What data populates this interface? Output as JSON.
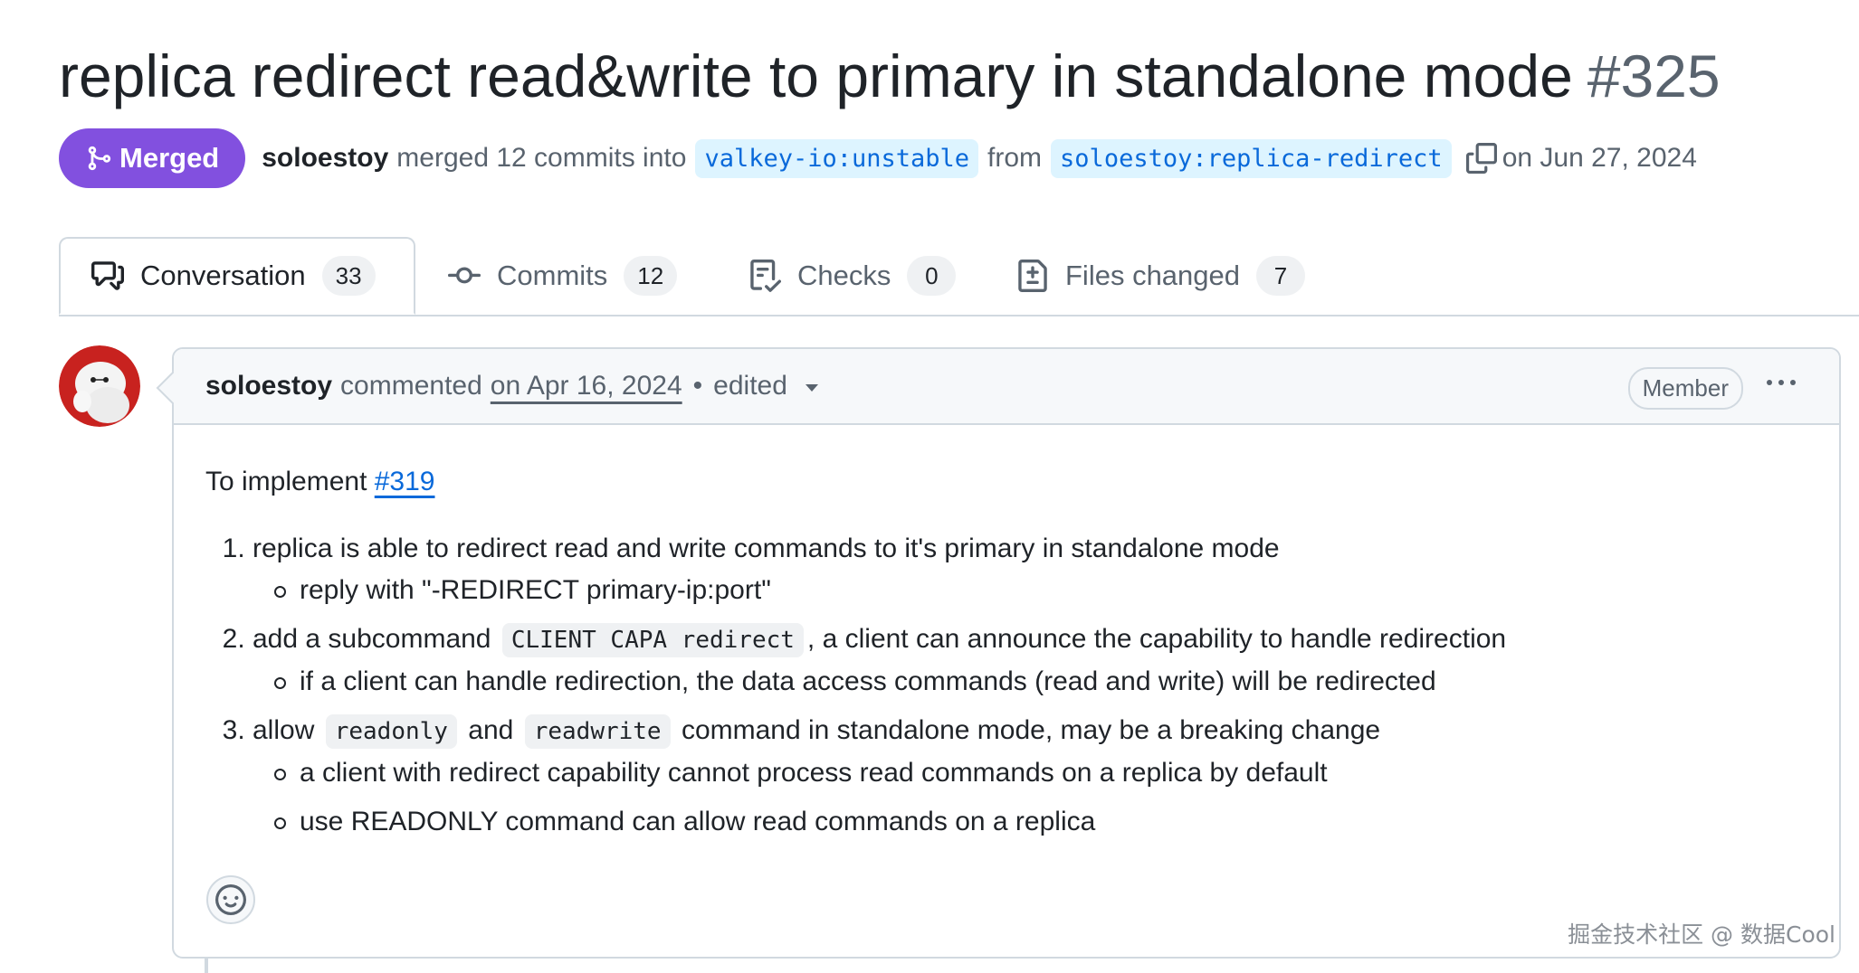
{
  "pr": {
    "title": "replica redirect read&write to primary in standalone mode",
    "number": "#325",
    "status": "Merged",
    "status_color": "#8250df",
    "author": "soloestoy",
    "action_text": "merged 12 commits into",
    "base_branch": "valkey-io:unstable",
    "from_text": "from",
    "head_branch": "soloestoy:replica-redirect",
    "merged_date": "on Jun 27, 2024"
  },
  "tabs": [
    {
      "label": "Conversation",
      "count": "33",
      "icon": "comment-discussion-icon",
      "active": true
    },
    {
      "label": "Commits",
      "count": "12",
      "icon": "git-commit-icon",
      "active": false
    },
    {
      "label": "Checks",
      "count": "0",
      "icon": "checklist-icon",
      "active": false
    },
    {
      "label": "Files changed",
      "count": "7",
      "icon": "file-diff-icon",
      "active": false
    }
  ],
  "comment": {
    "author": "soloestoy",
    "action": "commented",
    "date": "on Apr 16, 2024",
    "separator": "•",
    "edited": "edited",
    "role_badge": "Member",
    "intro_text": "To implement",
    "intro_link": "#319",
    "items": [
      {
        "parts": [
          "replica is able to redirect read and write commands to it's primary in standalone mode"
        ],
        "sub": [
          "reply with \"-REDIRECT primary-ip:port\""
        ]
      },
      {
        "pre": "add a subcommand",
        "code": "CLIENT CAPA redirect",
        "post": ", a client can announce the capability to handle redirection",
        "sub": [
          "if a client can handle redirection, the data access commands (read and write) will be redirected"
        ]
      },
      {
        "pre": "allow",
        "code1": "readonly",
        "mid": "and",
        "code2": "readwrite",
        "post": "command in standalone mode, may be a breaking change",
        "sub": [
          "a client with redirect capability cannot process read commands on a replica by default",
          "use READONLY command can allow read commands on a replica"
        ]
      }
    ]
  },
  "watermark": "掘金技术社区 @ 数据Cool"
}
